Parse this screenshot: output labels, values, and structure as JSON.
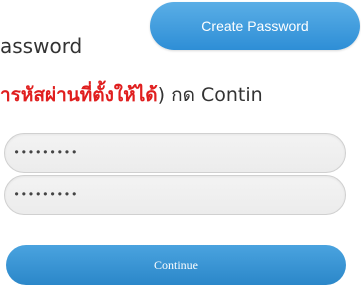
{
  "header": {
    "create_password_label": "Create Password"
  },
  "instructions": {
    "line1": "assword",
    "line2_red": "ำรหัสผ่านที่ตั้งให้ได้",
    "line2_rest": ") กด Contin"
  },
  "form": {
    "password_value": "•••••••••",
    "confirm_value": "•••••••••",
    "continue_label": "Continue"
  }
}
